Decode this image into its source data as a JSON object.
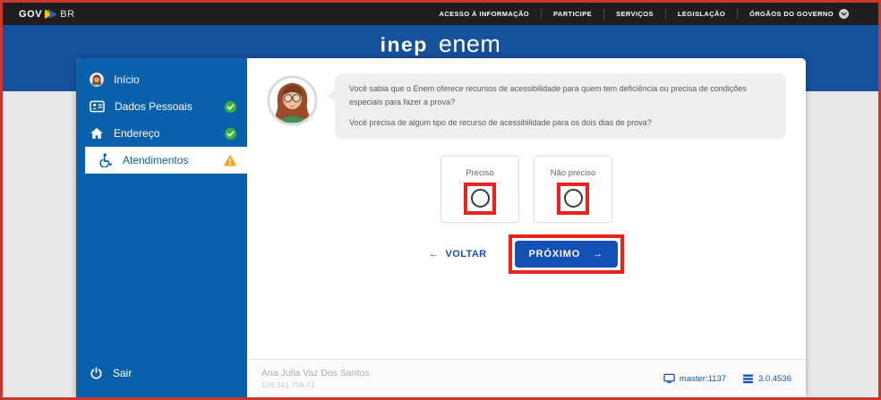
{
  "topbar": {
    "brand_gov": "GOV",
    "brand_br": "BR",
    "menu": [
      "ACESSO À INFORMAÇÃO",
      "PARTICIPE",
      "SERVIÇOS",
      "LEGISLAÇÃO",
      "ÓRGÃOS DO GOVERNO"
    ]
  },
  "header": {
    "inep": "inep",
    "enem": "enem"
  },
  "sidebar": {
    "items": [
      {
        "label": "Início",
        "status": "none",
        "selected": false
      },
      {
        "label": "Dados Pessoais",
        "status": "complete",
        "selected": false
      },
      {
        "label": "Endereço",
        "status": "complete",
        "selected": false
      },
      {
        "label": "Atendimentos",
        "status": "warning",
        "selected": true
      }
    ],
    "logout_label": "Sair"
  },
  "assistant": {
    "message_1": "Você sabia que o Enem oferece recursos de acessibilidade para quem tem deficiência ou precisa de condições especiais para fazer a prova?",
    "message_2": "Você precisa de algum tipo de recurso de acessibilidade para os dois dias de prova?"
  },
  "options": [
    {
      "label": "Preciso",
      "checked": false
    },
    {
      "label": "Não preciso",
      "checked": false
    }
  ],
  "actions": {
    "back_label": "VOLTAR",
    "back_arrow": "←",
    "next_label": "PRÓXIMO",
    "next_arrow": "→"
  },
  "footer": {
    "user_name": "Ana Julia Vaz Dos Santos",
    "user_document": "106.341.759-71",
    "environment": "master:1137",
    "version": "3.0.4536"
  },
  "colors": {
    "topbar_black": "#1E1E1E",
    "band_blue": "#15519D",
    "sidebar_blue": "#0B60AC",
    "link_blue": "#1351B4",
    "annotation_red": "#E8241E",
    "frame_red": "#C93732",
    "success_green": "#3CB43C",
    "warning_orange": "#F5A31E"
  }
}
